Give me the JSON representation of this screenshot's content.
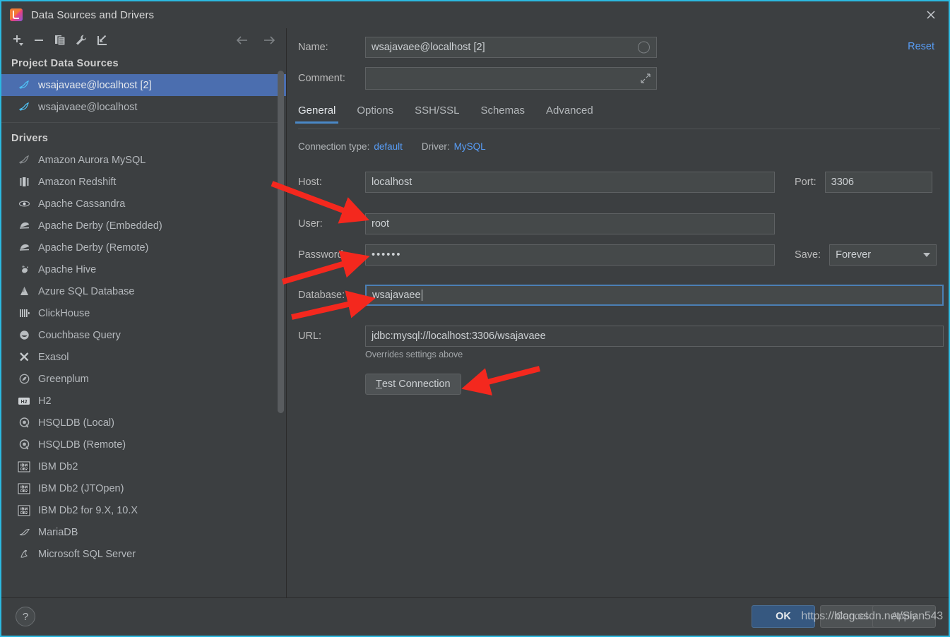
{
  "window": {
    "title": "Data Sources and Drivers",
    "app_icon": "intellij-idea-icon",
    "close_icon": "close-icon"
  },
  "toolbar": {
    "items": [
      {
        "name": "add-button",
        "icon": "plus-icon",
        "label": "+"
      },
      {
        "name": "remove-button",
        "icon": "minus-icon",
        "label": "−"
      },
      {
        "name": "duplicate-button",
        "icon": "copy-icon",
        "label": "copy"
      },
      {
        "name": "properties-button",
        "icon": "wrench-icon",
        "label": "wrench"
      },
      {
        "name": "import-button",
        "icon": "import-arrow-icon",
        "label": "import"
      }
    ],
    "back_icon": "arrow-left-icon",
    "forward_icon": "arrow-right-icon"
  },
  "sidebar": {
    "groups": [
      {
        "title": "Project Data Sources",
        "items": [
          {
            "label": "wsajavaee@localhost [2]",
            "icon": "mysql-dolphin-icon",
            "selected": true
          },
          {
            "label": "wsajavaee@localhost",
            "icon": "mysql-dolphin-icon",
            "selected": false
          }
        ]
      },
      {
        "title": "Drivers",
        "items": [
          {
            "label": "Amazon Aurora MySQL",
            "icon": "mysql-dolphin-icon",
            "selected": false
          },
          {
            "label": "Amazon Redshift",
            "icon": "redshift-icon",
            "selected": false
          },
          {
            "label": "Apache Cassandra",
            "icon": "cassandra-eye-icon",
            "selected": false
          },
          {
            "label": "Apache Derby (Embedded)",
            "icon": "derby-hat-icon",
            "selected": false
          },
          {
            "label": "Apache Derby (Remote)",
            "icon": "derby-hat-icon",
            "selected": false
          },
          {
            "label": "Apache Hive",
            "icon": "hive-bee-icon",
            "selected": false
          },
          {
            "label": "Azure SQL Database",
            "icon": "azure-triangle-icon",
            "selected": false
          },
          {
            "label": "ClickHouse",
            "icon": "clickhouse-bars-icon",
            "selected": false
          },
          {
            "label": "Couchbase Query",
            "icon": "couchbase-icon",
            "selected": false
          },
          {
            "label": "Exasol",
            "icon": "exasol-x-icon",
            "selected": false
          },
          {
            "label": "Greenplum",
            "icon": "greenplum-circle-icon",
            "selected": false
          },
          {
            "label": "H2",
            "icon": "h2-icon",
            "selected": false
          },
          {
            "label": "HSQLDB (Local)",
            "icon": "hsqldb-icon",
            "selected": false
          },
          {
            "label": "HSQLDB (Remote)",
            "icon": "hsqldb-icon",
            "selected": false
          },
          {
            "label": "IBM Db2",
            "icon": "ibm-db2-icon",
            "selected": false
          },
          {
            "label": "IBM Db2 (JTOpen)",
            "icon": "ibm-db2-icon",
            "selected": false
          },
          {
            "label": "IBM Db2 for 9.X, 10.X",
            "icon": "ibm-db2-icon",
            "selected": false
          },
          {
            "label": "MariaDB",
            "icon": "mariadb-seal-icon",
            "selected": false
          },
          {
            "label": "Microsoft SQL Server",
            "icon": "mssql-icon",
            "selected": false
          }
        ]
      }
    ]
  },
  "details": {
    "name_label": "Name:",
    "name_value": "wsajavaee@localhost [2]",
    "name_status_icon": "circle-indicator-icon",
    "comment_label": "Comment:",
    "comment_value": "",
    "comment_expand_icon": "expand-icon",
    "reset_label": "Reset",
    "tabs": [
      {
        "label": "General",
        "active": true
      },
      {
        "label": "Options",
        "active": false
      },
      {
        "label": "SSH/SSL",
        "active": false
      },
      {
        "label": "Schemas",
        "active": false
      },
      {
        "label": "Advanced",
        "active": false
      }
    ],
    "connection_type_label": "Connection type:",
    "connection_type_value": "default",
    "driver_label": "Driver:",
    "driver_value": "MySQL",
    "host_label": "Host:",
    "host_value": "localhost",
    "port_label": "Port:",
    "port_value": "3306",
    "user_label": "User:",
    "user_value": "root",
    "password_label": "Password:",
    "password_value": "••••••",
    "save_label": "Save:",
    "save_value": "Forever",
    "database_label": "Database:",
    "database_value": "wsajavaee",
    "url_label": "URL:",
    "url_value": "jdbc:mysql://localhost:3306/wsajavaee",
    "url_hint": "Overrides settings above",
    "test_connection_label": "Test Connection",
    "test_connection_mnemonic": "T"
  },
  "footer": {
    "help_label": "?",
    "ok_label": "OK",
    "cancel_label": "Cancel",
    "apply_label": "Apply"
  },
  "watermark": "https://blog.csdn.net/Sian543",
  "colors": {
    "background": "#3c3f41",
    "selection": "#4b6eaf",
    "link": "#589df6",
    "accent_tab": "#4a88c7",
    "ok_button": "#365880",
    "annotation_arrow": "#f4281e",
    "focused_border": "#4b7fb5",
    "window_border": "#2bb9e0"
  }
}
